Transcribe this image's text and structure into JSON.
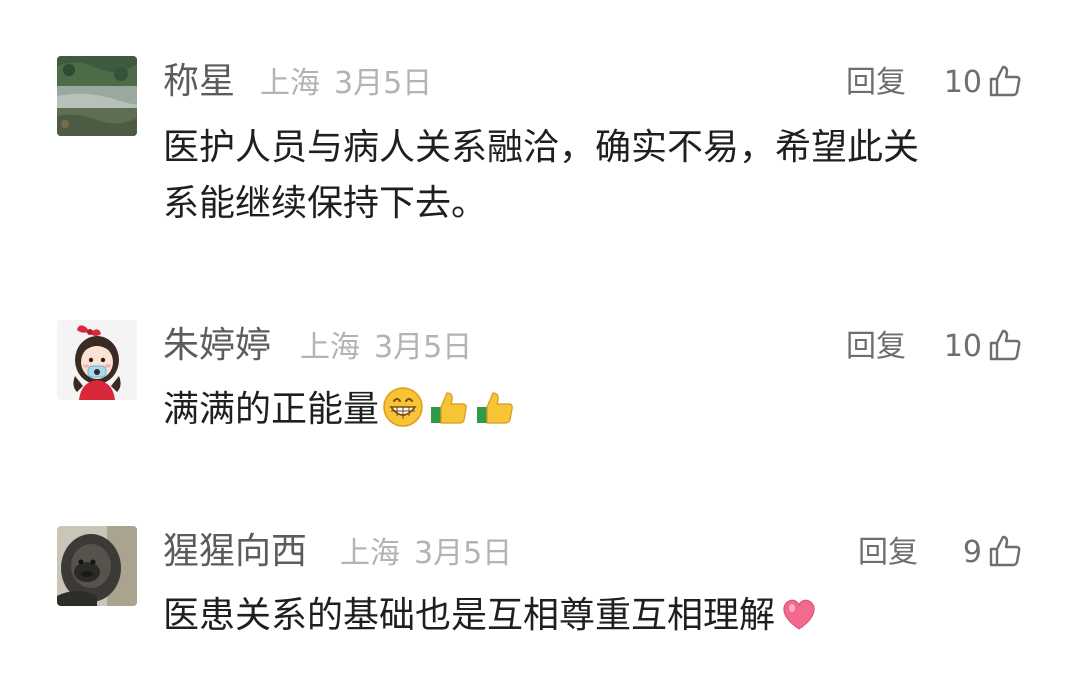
{
  "comments": [
    {
      "user": "称星",
      "location": "上海",
      "date": "3月5日",
      "reply_label": "回复",
      "likes": "10",
      "text_lines": [
        "医护人员与病人关系融洽，确实不易，希望此关",
        "系能继续保持下去。"
      ],
      "avatar": "landscape-photo",
      "emojis": []
    },
    {
      "user": "朱婷婷",
      "location": "上海",
      "date": "3月5日",
      "reply_label": "回复",
      "likes": "10",
      "text": "满满的正能量",
      "avatar": "cartoon-girl-mask",
      "emojis": [
        "grinning-face-emoji",
        "thumbs-up-emoji",
        "thumbs-up-emoji"
      ]
    },
    {
      "user": "猩猩向西",
      "location": "上海",
      "date": "3月5日",
      "reply_label": "回复",
      "likes": "9",
      "text": "医患关系的基础也是互相尊重互相理解",
      "avatar": "gorilla-photo",
      "emojis": [
        "heart-emoji"
      ]
    }
  ],
  "colors": {
    "username": "#5c5c5c",
    "meta": "#b3b3b3",
    "text": "#1f1f1f",
    "action": "#6e6e6e"
  }
}
